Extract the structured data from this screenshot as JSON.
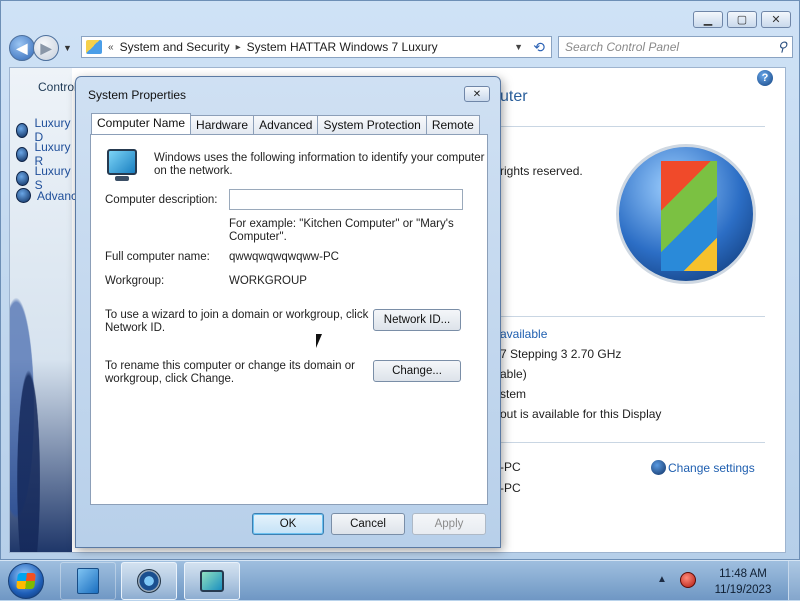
{
  "explorer": {
    "address_back_chevrons": "«",
    "breadcrumb": [
      "System and Security",
      "System HATTAR Windows 7 Luxury"
    ],
    "search_placeholder": "Search Control Panel",
    "left_pane": {
      "title": "Control",
      "links": [
        "Luxury D",
        "Luxury R",
        "Luxury S",
        "Advance"
      ]
    },
    "right_pane": {
      "title_fragment": "uter",
      "copyright_fragment": "rights reserved.",
      "rating_fragment": "available",
      "processor_fragment": "7 Stepping 3   2.70 GHz",
      "memory_fragment": "able)",
      "system_type_fragment": "stem",
      "pen_touch_fragment": "out is available for this Display",
      "computer_name_fragment": "-PC",
      "full_name_fragment": "-PC",
      "change_settings": "Change settings"
    }
  },
  "dialog": {
    "title": "System Properties",
    "tabs": [
      "Computer Name",
      "Hardware",
      "Advanced",
      "System Protection",
      "Remote"
    ],
    "active_tab": "Computer Name",
    "intro_line1": "Windows uses the following information to identify your computer",
    "intro_line2": "on the network.",
    "description_label": "Computer description:",
    "description_value": "",
    "example_line1": "For example: \"Kitchen Computer\" or \"Mary's",
    "example_line2": "Computer\".",
    "full_name_label": "Full computer name:",
    "full_name_value": "qwwqwqwqwqww-PC",
    "workgroup_label": "Workgroup:",
    "workgroup_value": "WORKGROUP",
    "network_id_text_line1": "To use a wizard to join a domain or workgroup, click",
    "network_id_text_line2": "Network ID.",
    "network_id_button": "Network ID...",
    "change_text_line1": "To rename this computer or change its domain or",
    "change_text_line2": "workgroup, click Change.",
    "change_button": "Change...",
    "ok_button": "OK",
    "cancel_button": "Cancel",
    "apply_button": "Apply",
    "close_glyph": "✕"
  },
  "taskbar": {
    "time": "11:48 AM",
    "date": "11/19/2023"
  },
  "colors": {
    "link": "#1f5fb0",
    "title_blue": "#2a5f9c",
    "taskbar": "#7ea3cc"
  }
}
